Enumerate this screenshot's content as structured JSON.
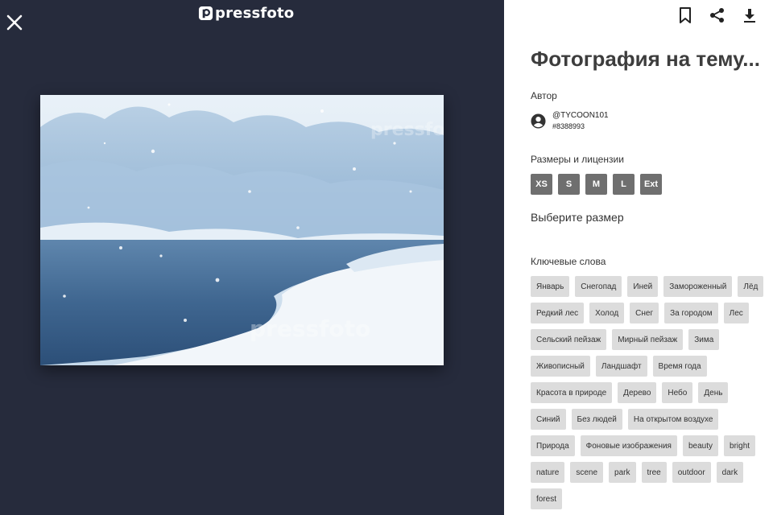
{
  "viewer": {
    "logo_text": "pressfoto",
    "watermark": "pressfoto"
  },
  "panel": {
    "title": "Фотография на тему...",
    "author_label": "Автор",
    "author_name": "@TYCOON101",
    "author_id": "#8388993",
    "sizes_label": "Размеры и лицензии",
    "sizes": [
      "XS",
      "S",
      "M",
      "L",
      "Ext"
    ],
    "choose_size": "Выберите размер",
    "keywords_label": "Ключевые слова",
    "tags": [
      "Январь",
      "Снегопад",
      "Иней",
      "Замороженный",
      "Лёд",
      "Редкий лес",
      "Холод",
      "Снег",
      "За городом",
      "Лес",
      "Сельский пейзаж",
      "Мирный пейзаж",
      "Зима",
      "Живописный",
      "Ландшафт",
      "Время года",
      "Красота в природе",
      "Дерево",
      "Небо",
      "День",
      "Синий",
      "Без людей",
      "На открытом воздухе",
      "Природа",
      "Фоновые изображения",
      "beauty",
      "bright",
      "nature",
      "scene",
      "park",
      "tree",
      "outdoor",
      "dark",
      "forest"
    ]
  },
  "icons": {
    "close": "close-icon",
    "bookmark": "bookmark-icon",
    "share": "share-icon",
    "download": "download-icon",
    "avatar": "account-circle-icon"
  },
  "colors": {
    "viewer_bg": "#262b3c",
    "size_button": "#6f6f6f",
    "tag_bg": "#dcdcdc",
    "title": "#3d3d3d"
  }
}
